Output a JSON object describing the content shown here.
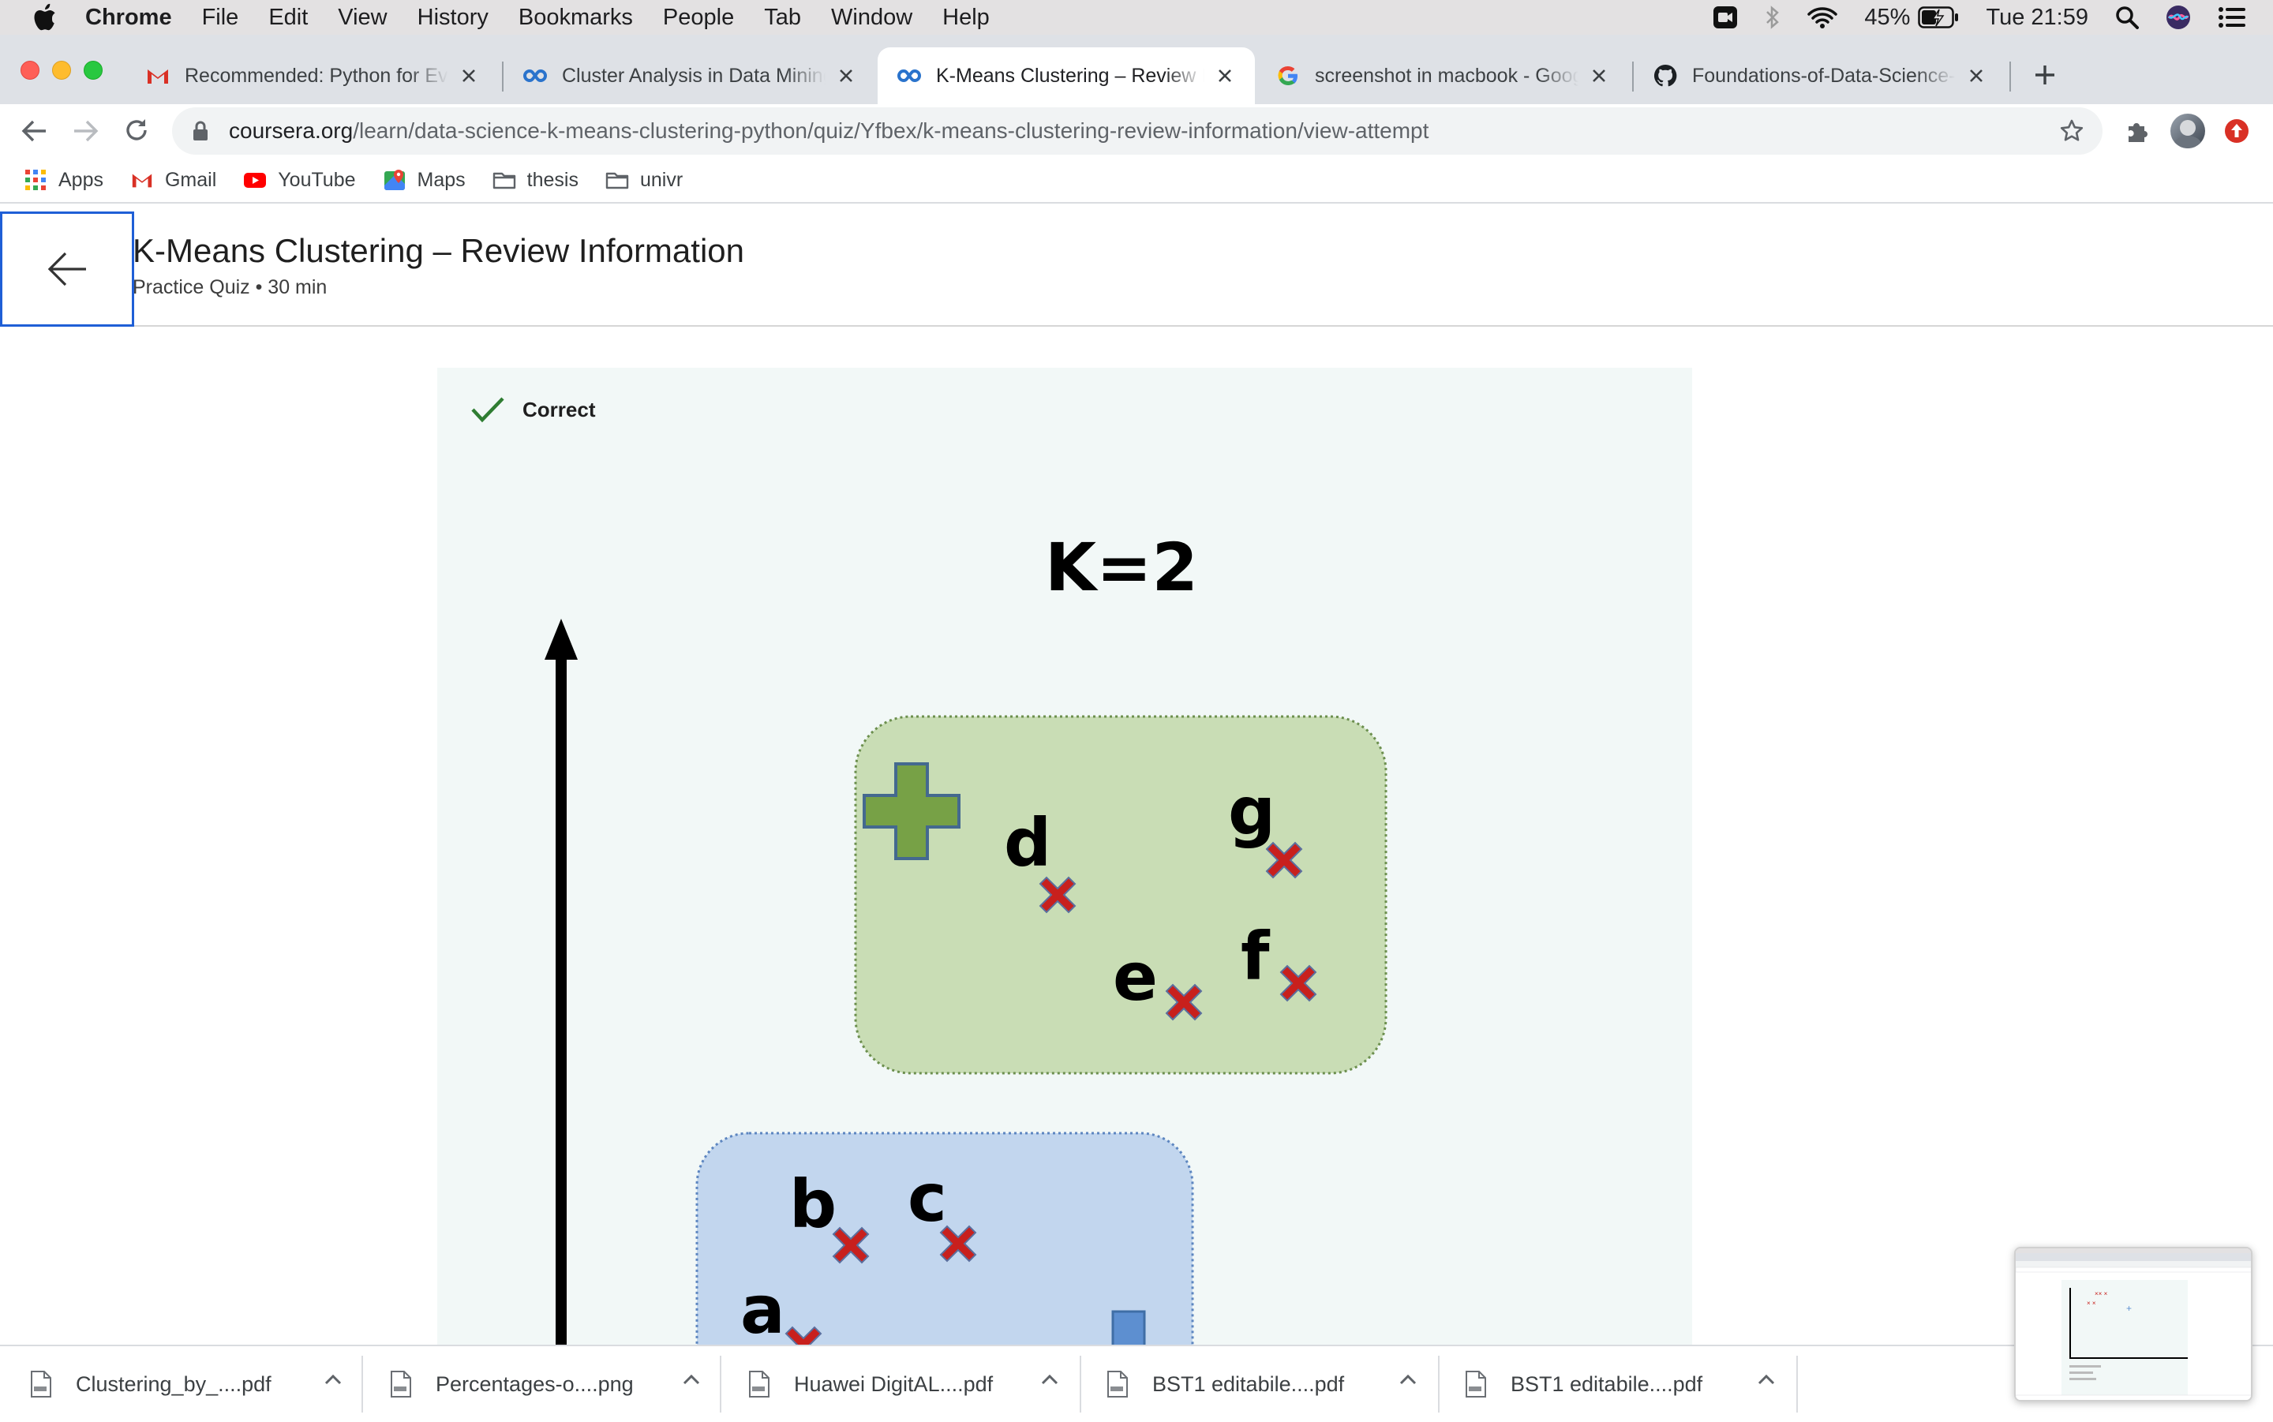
{
  "menubar": {
    "app": "Chrome",
    "items": [
      "File",
      "Edit",
      "View",
      "History",
      "Bookmarks",
      "People",
      "Tab",
      "Window",
      "Help"
    ],
    "battery": "45%",
    "clock": "Tue 21:59"
  },
  "tabs": [
    {
      "title": "Recommended: Python for Eve",
      "icon": "gmail-icon"
    },
    {
      "title": "Cluster Analysis in Data Mining",
      "icon": "coursera-icon"
    },
    {
      "title": "K-Means Clustering – Review Infor",
      "icon": "coursera-icon",
      "active": true
    },
    {
      "title": "screenshot in macbook - Goog",
      "icon": "google-icon"
    },
    {
      "title": "Foundations-of-Data-Science-",
      "icon": "github-icon"
    }
  ],
  "address": {
    "host": "coursera.org",
    "path": "/learn/data-science-k-means-clustering-python/quiz/Yfbex/k-means-clustering-review-information/view-attempt"
  },
  "bookmarks": [
    {
      "label": "Apps",
      "icon": "apps-grid-icon"
    },
    {
      "label": "Gmail",
      "icon": "gmail-icon"
    },
    {
      "label": "YouTube",
      "icon": "youtube-icon"
    },
    {
      "label": "Maps",
      "icon": "maps-icon"
    },
    {
      "label": "thesis",
      "icon": "folder-icon"
    },
    {
      "label": "univr",
      "icon": "folder-icon"
    }
  ],
  "page": {
    "title": "K-Means Clustering – Review Information",
    "subtitle": "Practice Quiz • 30 min",
    "status": "Correct"
  },
  "figure": {
    "title": "K=2",
    "points": [
      "a",
      "b",
      "c",
      "d",
      "e",
      "f",
      "g"
    ],
    "colors": {
      "green_cluster": "#c9ddb5",
      "blue_cluster": "#c2d6ee",
      "marker": "#c8201d",
      "centroid_green": "#77a146",
      "centroid_blue": "#5d8fd0"
    }
  },
  "downloads": [
    {
      "name": "Clustering_by_....pdf"
    },
    {
      "name": "Percentages-o....png"
    },
    {
      "name": "Huawei DigitAL....pdf"
    },
    {
      "name": "BST1 editabile....pdf"
    },
    {
      "name": "BST1 editabile....pdf"
    }
  ]
}
